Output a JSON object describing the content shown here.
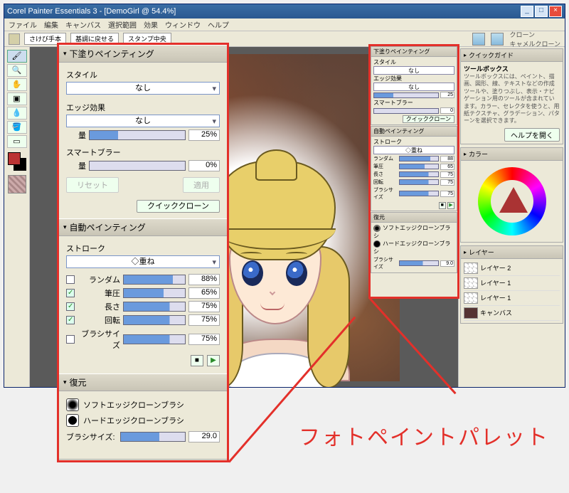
{
  "window": {
    "title": "Corel Painter Essentials 3 - [DemoGirl @ 54.4%]"
  },
  "menu": {
    "items": [
      "ファイル",
      "編集",
      "キャンバス",
      "選択範囲",
      "効果",
      "ウィンドウ",
      "ヘルプ"
    ]
  },
  "prop_bar": {
    "tabs": [
      "さけび手本",
      "基調に戻せる",
      "スタンプ中央"
    ],
    "brush_category": "クローン",
    "brush_variant": "キャメルクローン"
  },
  "help_panel": {
    "title": "クイックガイド",
    "heading": "ツールボックス",
    "body": "ツールボックスには、ペイント、描画、図形、線、テキストなどの作成ツールや、塗りつぶし、表示・ナビゲーション用のツールが含まれています。カラー、セレクタを使うと、用紙テクスチャ、グラデーション、パターンを選択できます。",
    "help_btn": "ヘルプを開く"
  },
  "color_panel": {
    "title": "カラー"
  },
  "layers_panel": {
    "title": "レイヤー",
    "rows": [
      "レイヤー 2",
      "レイヤー 1",
      "レイヤー 1",
      "キャンバス"
    ]
  },
  "annotation": "フォトペイントパレット",
  "photo_paint": {
    "underpaint": {
      "title": "下塗りペインティング",
      "style_label": "スタイル",
      "style_value": "なし",
      "edge_label": "エッジ効果",
      "edge_value": "なし",
      "amount_label": "量",
      "amount_value": "25%",
      "blur_label": "スマートブラー",
      "blur_amount_label": "量",
      "blur_value": "0%",
      "reset_btn": "リセット",
      "apply_btn": "適用",
      "quickclone_btn": "クイッククローン"
    },
    "autopaint": {
      "title": "自動ペインティング",
      "stroke_label": "ストローク",
      "stroke_value": "◇重ね",
      "params": [
        {
          "label": "ランダム",
          "value": "88%",
          "checked": false,
          "fill": "fill80"
        },
        {
          "label": "筆圧",
          "value": "65%",
          "checked": true,
          "fill": "fill65"
        },
        {
          "label": "長さ",
          "value": "75%",
          "checked": true,
          "fill": "fill75"
        },
        {
          "label": "回転",
          "value": "75%",
          "checked": true,
          "fill": "fill75"
        },
        {
          "label": "ブラシサイズ",
          "value": "75%",
          "checked": false,
          "fill": "fill75"
        }
      ]
    },
    "restore": {
      "title": "復元",
      "soft_label": "ソフトエッジクローンブラシ",
      "hard_label": "ハードエッジクローンブラシ",
      "brushsize_label": "ブラシサイズ:",
      "brushsize_value": "29.0"
    }
  },
  "mini": {
    "underpaint_title": "下塗りペインティング",
    "style_label": "スタイル",
    "style_value": "なし",
    "edge_label": "エッジ効果",
    "edge_value": "なし",
    "amount_value": "25",
    "blur_label": "スマートブラー",
    "blur_value": "0",
    "quickclone_btn": "クイッククローン",
    "autopaint_title": "自動ペインティング",
    "stroke_label": "ストローク",
    "stroke_value": "◇重ね",
    "p1_label": "ランダム",
    "p1_value": "88",
    "p2_label": "筆圧",
    "p2_value": "65",
    "p3_label": "長さ",
    "p3_value": "75",
    "p4_label": "回転",
    "p4_value": "75",
    "p5_label": "ブラシサイズ",
    "p5_value": "75",
    "restore_title": "復元",
    "soft_label": "ソフトエッジクローンブラシ",
    "hard_label": "ハードエッジクローンブラシ",
    "brushsize_label": "ブラシサイズ",
    "brushsize_value": "9.0"
  }
}
